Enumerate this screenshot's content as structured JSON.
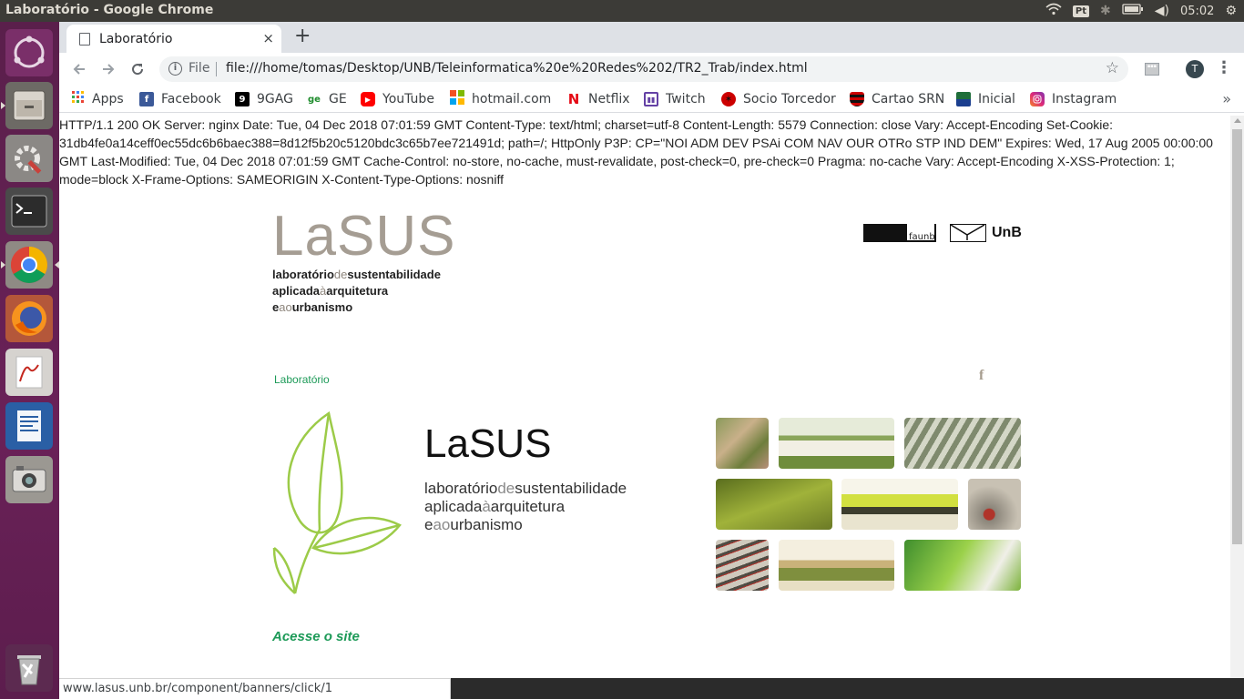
{
  "os": {
    "window_title": "Laboratório - Google Chrome",
    "keyboard_layout": "Pt",
    "clock": "05:02",
    "tray_icons": [
      "wifi-icon",
      "keyboard-layout-badge",
      "bluetooth-icon",
      "battery-icon",
      "volume-icon",
      "settings-gear-icon"
    ],
    "launcher": [
      "ubuntu-dash-icon",
      "files-icon",
      "system-settings-icon",
      "terminal-icon",
      "chrome-icon",
      "firefox-icon",
      "pdf-viewer-icon",
      "writer-icon",
      "camera-icon",
      "trash-icon"
    ]
  },
  "browser": {
    "tab": {
      "title": "Laboratório",
      "close": "×"
    },
    "new_tab": "+",
    "omnibox": {
      "scheme_label": "File",
      "url": "file:///home/tomas/Desktop/UNB/Teleinformatica%20e%20Redes%202/TR2_Trab/index.html"
    },
    "profile_initial": "T",
    "bookmarks": [
      {
        "label": "Apps",
        "icon": "apps-grid-icon"
      },
      {
        "label": "Facebook",
        "icon": "facebook-icon"
      },
      {
        "label": "9GAG",
        "icon": "9gag-icon"
      },
      {
        "label": "GE",
        "icon": "ge-icon"
      },
      {
        "label": "YouTube",
        "icon": "youtube-icon"
      },
      {
        "label": "hotmail.com",
        "icon": "microsoft-icon"
      },
      {
        "label": "Netflix",
        "icon": "netflix-icon"
      },
      {
        "label": "Twitch",
        "icon": "twitch-icon"
      },
      {
        "label": "Socio Torcedor",
        "icon": "flamengo-icon"
      },
      {
        "label": "Cartao SRN",
        "icon": "flamengo-shield-icon"
      },
      {
        "label": "Inicial",
        "icon": "inicial-icon"
      },
      {
        "label": "Instagram",
        "icon": "instagram-icon"
      }
    ],
    "bookmarks_overflow": "»",
    "status_url": "www.lasus.unb.br/component/banners/click/1"
  },
  "page": {
    "http_header_text": "HTTP/1.1 200 OK Server: nginx Date: Tue, 04 Dec 2018 07:01:59 GMT Content-Type: text/html; charset=utf-8 Content-Length: 5579 Connection: close Vary: Accept-Encoding Set-Cookie: 31db4fe0a14ceff0ec55dc6b6baec388=8d12f5b20c5120bdc3c65b7ee721491d; path=/; HttpOnly P3P: CP=\"NOI ADM DEV PSAi COM NAV OUR OTRo STP IND DEM\" Expires: Wed, 17 Aug 2005 00:00:00 GMT Last-Modified: Tue, 04 Dec 2018 07:01:59 GMT Cache-Control: no-store, no-cache, must-revalidate, post-check=0, pre-check=0 Pragma: no-cache Vary: Accept-Encoding X-XSS-Protection: 1; mode=block X-Frame-Options: SAMEORIGIN X-Content-Type-Options: nosniff",
    "logo": {
      "name": "LaSUS",
      "line1_a": "laboratório",
      "line1_b": "de",
      "line1_c": "sustentabilidade",
      "line2_a": "aplicada",
      "line2_b": "à",
      "line2_c": "arquitetura",
      "line3_a": "e",
      "line3_b": "ao",
      "line3_c": "urbanismo"
    },
    "faunb_label": "faunb",
    "unb_label": "UnB",
    "nav_link": "Laboratório",
    "facebook_glyph": "f",
    "banner": {
      "title": "LaSUS",
      "line1_a": "laboratório",
      "line1_b": "de",
      "line1_c": "sustentabilidade",
      "line2_a": "aplicada",
      "line2_b": "à",
      "line2_c": "arquitetura",
      "line3_a": "e",
      "line3_b": "ao",
      "line3_c": "urbanismo"
    },
    "cta": "Acesse o site"
  },
  "colors": {
    "accent_green": "#1d9a58",
    "logo_gray": "#a59d93",
    "leaf_green": "#9ccb48",
    "ubuntu_panel": "#3c3b37",
    "launcher_purple": "#5e1f4f"
  }
}
